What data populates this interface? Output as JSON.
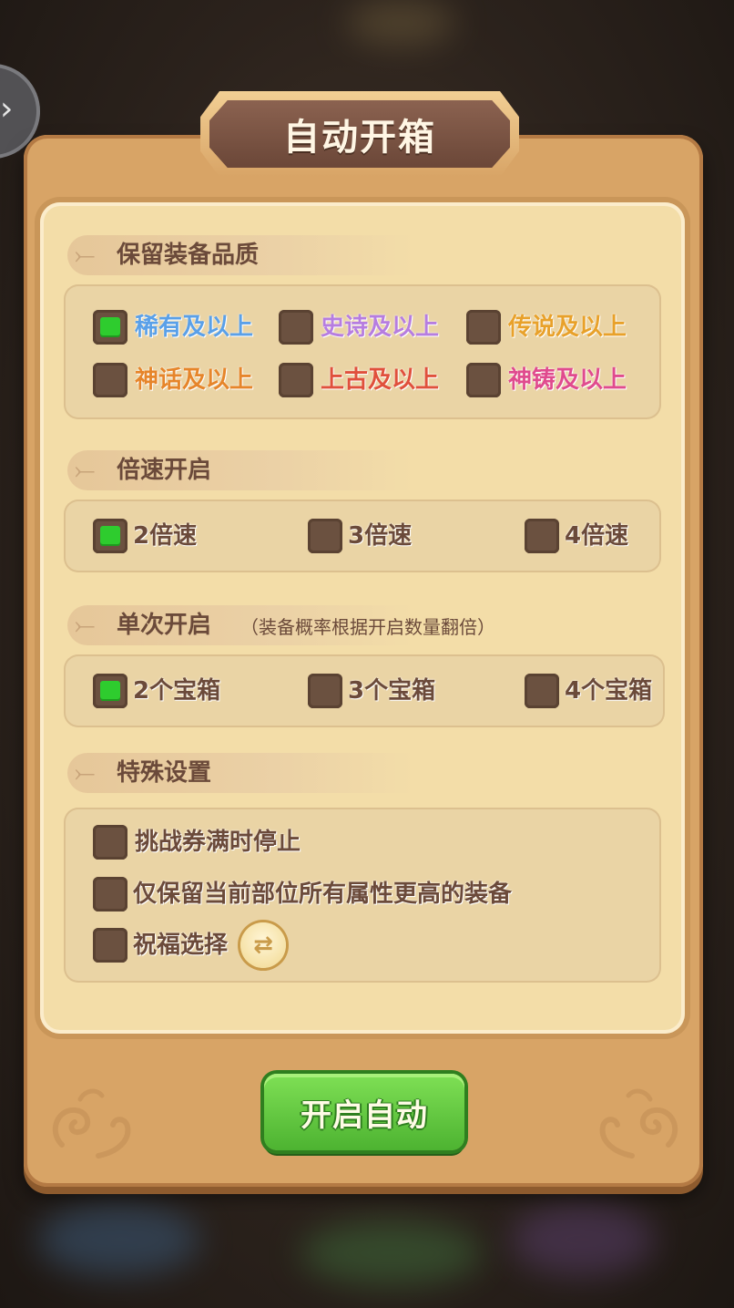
{
  "dialog": {
    "title": "自动开箱"
  },
  "sections": {
    "quality": {
      "title": "保留装备品质",
      "options": [
        {
          "label": "稀有及以上",
          "checked": true
        },
        {
          "label": "史诗及以上",
          "checked": false
        },
        {
          "label": "传说及以上",
          "checked": false
        },
        {
          "label": "神话及以上",
          "checked": false
        },
        {
          "label": "上古及以上",
          "checked": false
        },
        {
          "label": "神铸及以上",
          "checked": false
        }
      ]
    },
    "speed": {
      "title": "倍速开启",
      "options": [
        {
          "label": "2倍速",
          "checked": true
        },
        {
          "label": "3倍速",
          "checked": false
        },
        {
          "label": "4倍速",
          "checked": false
        }
      ]
    },
    "batch": {
      "title": "单次开启",
      "note": "（装备概率根据开启数量翻倍）",
      "options": [
        {
          "label": "2个宝箱",
          "checked": true
        },
        {
          "label": "3个宝箱",
          "checked": false
        },
        {
          "label": "4个宝箱",
          "checked": false
        }
      ]
    },
    "special": {
      "title": "特殊设置",
      "options": [
        {
          "label": "挑战券满时停止",
          "checked": false
        },
        {
          "label": "仅保留当前部位所有属性更高的装备",
          "checked": false
        },
        {
          "label": "祝福选择",
          "checked": false
        }
      ]
    }
  },
  "buttons": {
    "start_label": "开启自动"
  },
  "icons": {
    "side_tab": "chevron-right-icon",
    "section_marker": "leaf-arrow-icon",
    "swap": "swap-arrows-icon"
  },
  "colors": {
    "checked_green": "#2ecc2e",
    "rare": "#5aa0e8",
    "epic": "#b67de0",
    "legend": "#e8a12a",
    "myth": "#e6852a",
    "ancient": "#e0503c",
    "divine": "#e04b8e",
    "button_green": "#4db331"
  }
}
